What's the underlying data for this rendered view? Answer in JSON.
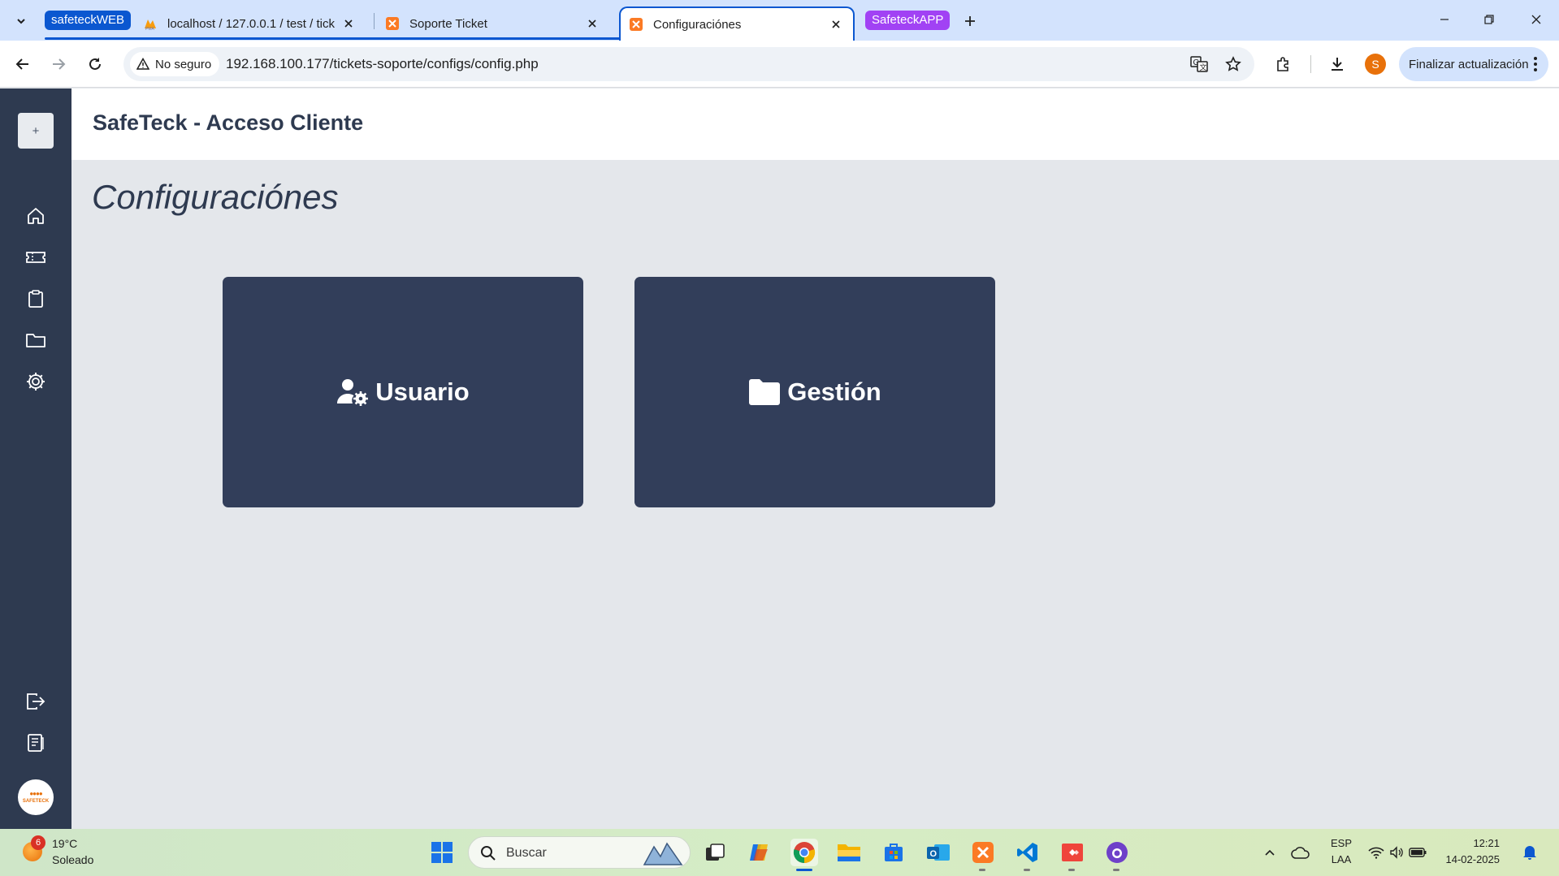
{
  "browser": {
    "tab_groups": [
      {
        "label": "safeteckWEB",
        "color": "#0b57d0"
      },
      {
        "label": "SafeteckAPP",
        "color": "#a142f4"
      }
    ],
    "tabs": [
      {
        "title": "localhost / 127.0.0.1 / test / tick",
        "favicon": "phpmyadmin-icon"
      },
      {
        "title": "Soporte Ticket",
        "favicon": "xampp-icon"
      },
      {
        "title": "Configuraciónes",
        "favicon": "xampp-icon",
        "active": true
      }
    ],
    "security_label": "No seguro",
    "url": "192.168.100.177/tickets-soporte/configs/config.php",
    "profile_initial": "S",
    "update_label": "Finalizar actualización"
  },
  "app": {
    "header_title": "SafeTeck - Acceso Cliente",
    "add_button_label": "+",
    "page_title": "Configuraciónes",
    "cards": [
      {
        "label": "Usuario",
        "icon": "user-gear-icon"
      },
      {
        "label": "Gestión",
        "icon": "folder-icon"
      }
    ],
    "sidebar_icons": [
      "home-icon",
      "ticket-icon",
      "clipboard-icon",
      "folder-icon",
      "settings-icon",
      "logout-icon",
      "notes-icon"
    ],
    "logo_text": "SAFETECK"
  },
  "taskbar": {
    "weather_badge": "6",
    "temperature": "19°C",
    "condition": "Soleado",
    "search_placeholder": "Buscar",
    "language": "ESP",
    "layout": "LAA",
    "time": "12:21",
    "date": "14-02-2025"
  },
  "colors": {
    "sidebar": "#2e3a50",
    "card": "#323e5a",
    "content_bg": "#e4e7eb",
    "tab_strip": "#d3e3fd",
    "accent": "#0b57d0"
  }
}
